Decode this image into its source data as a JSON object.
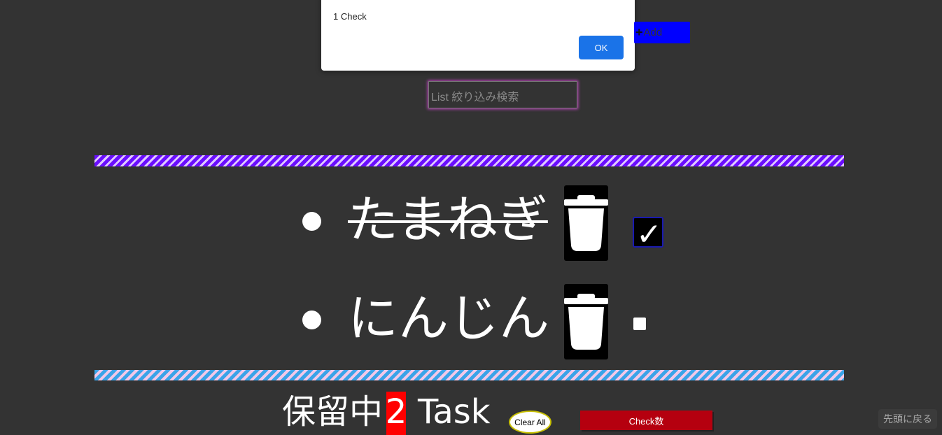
{
  "dialog": {
    "title": "…",
    "message": "1  Check",
    "ok_label": "OK"
  },
  "add_button": {
    "icon": "plus-icon",
    "label": "Add"
  },
  "search": {
    "placeholder": "List 絞り込み検索",
    "value": ""
  },
  "todo_items": [
    {
      "label": "たまねぎ",
      "checked": true,
      "check_mark": "✓"
    },
    {
      "label": "にんじん",
      "checked": false
    }
  ],
  "footer": {
    "pending_label": "保留中",
    "pending_count": "2",
    "task_word": "Task",
    "clear_all_label": "Clear All",
    "check_count_label": "Check数"
  },
  "back_to_top": "先頭に戻る",
  "colors": {
    "background": "#333333",
    "add_button": "#0000ff",
    "ok_button": "#1a73e8",
    "count_badge": "#ff0000",
    "check_count_button": "#b5000f"
  }
}
